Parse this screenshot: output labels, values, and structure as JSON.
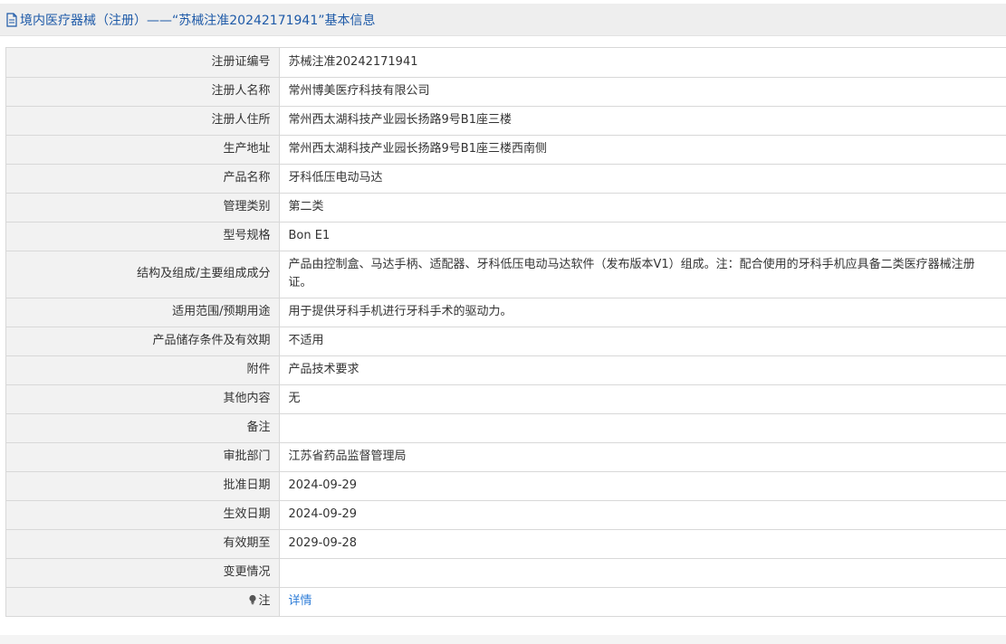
{
  "header": {
    "title": "境内医疗器械（注册）——“苏械注准20242171941”基本信息",
    "icon": "document-icon"
  },
  "rows": [
    {
      "label": "注册证编号",
      "value": "苏械注准20242171941"
    },
    {
      "label": "注册人名称",
      "value": "常州博美医疗科技有限公司"
    },
    {
      "label": "注册人住所",
      "value": "常州西太湖科技产业园长扬路9号B1座三楼"
    },
    {
      "label": "生产地址",
      "value": "常州西太湖科技产业园长扬路9号B1座三楼西南侧"
    },
    {
      "label": "产品名称",
      "value": "牙科低压电动马达"
    },
    {
      "label": "管理类别",
      "value": "第二类"
    },
    {
      "label": "型号规格",
      "value": "Bon E1"
    },
    {
      "label": "结构及组成/主要组成成分",
      "value": "产品由控制盒、马达手柄、适配器、牙科低压电动马达软件（发布版本V1）组成。注：配合使用的牙科手机应具备二类医疗器械注册证。"
    },
    {
      "label": "适用范围/预期用途",
      "value": "用于提供牙科手机进行牙科手术的驱动力。"
    },
    {
      "label": "产品储存条件及有效期",
      "value": "不适用"
    },
    {
      "label": "附件",
      "value": "产品技术要求"
    },
    {
      "label": "其他内容",
      "value": "无"
    },
    {
      "label": "备注",
      "value": ""
    },
    {
      "label": "审批部门",
      "value": "江苏省药品监督管理局"
    },
    {
      "label": "批准日期",
      "value": "2024-09-29"
    },
    {
      "label": "生效日期",
      "value": "2024-09-29"
    },
    {
      "label": "有效期至",
      "value": "2029-09-28"
    },
    {
      "label": "变更情况",
      "value": ""
    }
  ],
  "note": {
    "label": "注",
    "icon": "lightbulb-icon",
    "link_text": "详情"
  },
  "colors": {
    "title": "#1e5aa8",
    "link": "#2f7ed8",
    "label_bg": "#f2f2f2",
    "header_bg": "#eeeeee"
  }
}
